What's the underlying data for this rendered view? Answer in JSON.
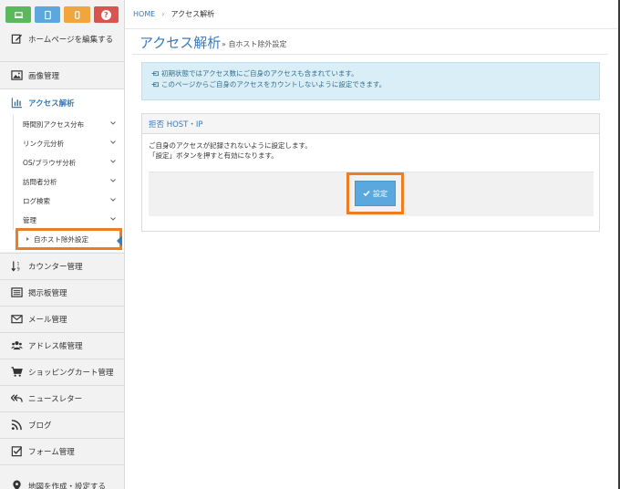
{
  "breadcrumb": {
    "home": "HOME",
    "current": "アクセス解析"
  },
  "page": {
    "title": "アクセス解析",
    "subtitle": "» 自ホスト除外設定"
  },
  "info": {
    "line1": "初期状態ではアクセス数にご自身のアクセスも含まれています。",
    "line2": "このページからご自身のアクセスをカウントしないように設定できます。"
  },
  "panel": {
    "title": "拒否 HOST・IP",
    "line1": "ご自身のアクセスが記録されないように設定します。",
    "line2": "「設定」ボタンを押すと有効になります。",
    "button": "設定"
  },
  "sidebar": {
    "edit": "ホームページを編集する",
    "image": "画像管理",
    "access": "アクセス解析",
    "sub": [
      "時間別アクセス分布",
      "リンク元分析",
      "OS/ブラウザ分析",
      "訪問者分析",
      "ログ検索",
      "管理"
    ],
    "current_sub": "自ホスト除外設定",
    "items": [
      "カウンター管理",
      "掲示板管理",
      "メール管理",
      "アドレス帳管理",
      "ショッピングカート管理",
      "ニュースレター",
      "ブログ",
      "フォーム管理",
      "地図を作成・設定する"
    ]
  },
  "colors": {
    "accent": "#3b7ab8",
    "highlight": "#ec7d23"
  }
}
